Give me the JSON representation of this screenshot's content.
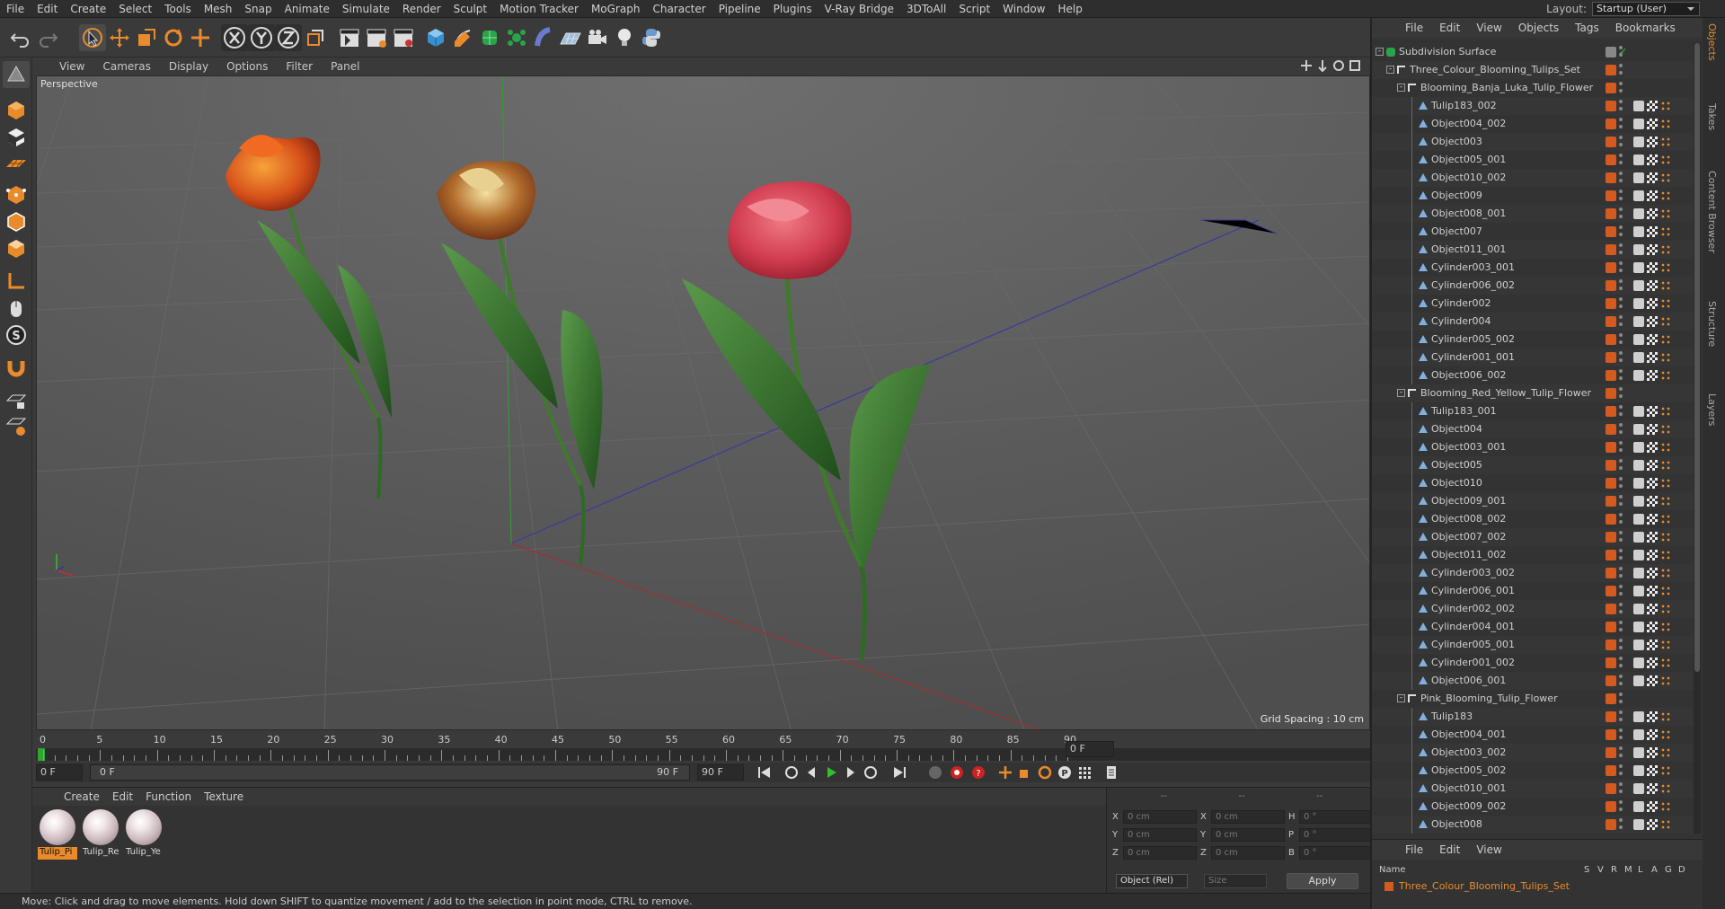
{
  "menu": [
    "File",
    "Edit",
    "Create",
    "Select",
    "Tools",
    "Mesh",
    "Snap",
    "Animate",
    "Simulate",
    "Render",
    "Sculpt",
    "Motion Tracker",
    "MoGraph",
    "Character",
    "Pipeline",
    "Plugins",
    "V-Ray Bridge",
    "3DToAll",
    "Script",
    "Window",
    "Help"
  ],
  "layout": {
    "label": "Layout:",
    "value": "Startup (User)"
  },
  "viewport": {
    "menu": [
      "View",
      "Cameras",
      "Display",
      "Options",
      "Filter",
      "Panel"
    ],
    "label": "Perspective",
    "grid_spacing": "Grid Spacing : 10 cm",
    "axis_y": "y",
    "axis_x": "x",
    "axis_z": "z"
  },
  "timeline": {
    "ticks": [
      "0",
      "5",
      "10",
      "15",
      "20",
      "25",
      "30",
      "35",
      "40",
      "45",
      "50",
      "55",
      "60",
      "65",
      "70",
      "75",
      "80",
      "85",
      "90"
    ],
    "end_field": "0 F",
    "start_field": "0 F",
    "range_start": "0 F",
    "range_end": "90 F",
    "max_field": "90 F"
  },
  "materials": {
    "menu": [
      "Create",
      "Edit",
      "Function",
      "Texture"
    ],
    "items": [
      {
        "name": "Tulip_Pi",
        "selected": true
      },
      {
        "name": "Tulip_Re",
        "selected": false
      },
      {
        "name": "Tulip_Ye",
        "selected": false
      }
    ]
  },
  "coords": {
    "header": [
      "--",
      "--",
      "--"
    ],
    "rows": [
      {
        "a": "X",
        "v1": "0 cm",
        "b": "X",
        "v2": "0 cm",
        "c": "H",
        "v3": "0 °"
      },
      {
        "a": "Y",
        "v1": "0 cm",
        "b": "Y",
        "v2": "0 cm",
        "c": "P",
        "v3": "0 °"
      },
      {
        "a": "Z",
        "v1": "0 cm",
        "b": "Z",
        "v2": "0 cm",
        "c": "B",
        "v3": "0 °"
      }
    ],
    "mode": "Object (Rel)",
    "size": "Size",
    "apply": "Apply"
  },
  "status": "Move: Click and drag to move elements. Hold down SHIFT to quantize movement / add to the selection in point mode, CTRL to remove.",
  "object_manager": {
    "menu": [
      "File",
      "Edit",
      "View",
      "Objects",
      "Tags",
      "Bookmarks"
    ],
    "objects": [
      {
        "name": "Subdivision Surface",
        "level": 0,
        "type": "sds"
      },
      {
        "name": "Three_Colour_Blooming_Tulips_Set",
        "level": 1,
        "type": "null"
      },
      {
        "name": "Blooming_Banja_Luka_Tulip_Flower",
        "level": 2,
        "type": "null"
      },
      {
        "name": "Tulip183_002",
        "level": 3,
        "type": "poly"
      },
      {
        "name": "Object004_002",
        "level": 3,
        "type": "poly"
      },
      {
        "name": "Object003",
        "level": 3,
        "type": "poly"
      },
      {
        "name": "Object005_001",
        "level": 3,
        "type": "poly"
      },
      {
        "name": "Object010_002",
        "level": 3,
        "type": "poly"
      },
      {
        "name": "Object009",
        "level": 3,
        "type": "poly"
      },
      {
        "name": "Object008_001",
        "level": 3,
        "type": "poly"
      },
      {
        "name": "Object007",
        "level": 3,
        "type": "poly"
      },
      {
        "name": "Object011_001",
        "level": 3,
        "type": "poly"
      },
      {
        "name": "Cylinder003_001",
        "level": 3,
        "type": "poly"
      },
      {
        "name": "Cylinder006_002",
        "level": 3,
        "type": "poly"
      },
      {
        "name": "Cylinder002",
        "level": 3,
        "type": "poly"
      },
      {
        "name": "Cylinder004",
        "level": 3,
        "type": "poly"
      },
      {
        "name": "Cylinder005_002",
        "level": 3,
        "type": "poly"
      },
      {
        "name": "Cylinder001_001",
        "level": 3,
        "type": "poly"
      },
      {
        "name": "Object006_002",
        "level": 3,
        "type": "poly"
      },
      {
        "name": "Blooming_Red_Yellow_Tulip_Flower",
        "level": 2,
        "type": "null"
      },
      {
        "name": "Tulip183_001",
        "level": 3,
        "type": "poly"
      },
      {
        "name": "Object004",
        "level": 3,
        "type": "poly"
      },
      {
        "name": "Object003_001",
        "level": 3,
        "type": "poly"
      },
      {
        "name": "Object005",
        "level": 3,
        "type": "poly"
      },
      {
        "name": "Object010",
        "level": 3,
        "type": "poly"
      },
      {
        "name": "Object009_001",
        "level": 3,
        "type": "poly"
      },
      {
        "name": "Object008_002",
        "level": 3,
        "type": "poly"
      },
      {
        "name": "Object007_002",
        "level": 3,
        "type": "poly"
      },
      {
        "name": "Object011_002",
        "level": 3,
        "type": "poly"
      },
      {
        "name": "Cylinder003_002",
        "level": 3,
        "type": "poly"
      },
      {
        "name": "Cylinder006_001",
        "level": 3,
        "type": "poly"
      },
      {
        "name": "Cylinder002_002",
        "level": 3,
        "type": "poly"
      },
      {
        "name": "Cylinder004_001",
        "level": 3,
        "type": "poly"
      },
      {
        "name": "Cylinder005_001",
        "level": 3,
        "type": "poly"
      },
      {
        "name": "Cylinder001_002",
        "level": 3,
        "type": "poly"
      },
      {
        "name": "Object006_001",
        "level": 3,
        "type": "poly"
      },
      {
        "name": "Pink_Blooming_Tulip_Flower",
        "level": 2,
        "type": "null"
      },
      {
        "name": "Tulip183",
        "level": 3,
        "type": "poly"
      },
      {
        "name": "Object004_001",
        "level": 3,
        "type": "poly"
      },
      {
        "name": "Object003_002",
        "level": 3,
        "type": "poly"
      },
      {
        "name": "Object005_002",
        "level": 3,
        "type": "poly"
      },
      {
        "name": "Object010_001",
        "level": 3,
        "type": "poly"
      },
      {
        "name": "Object009_002",
        "level": 3,
        "type": "poly"
      },
      {
        "name": "Object008",
        "level": 3,
        "type": "poly"
      }
    ]
  },
  "layers": {
    "menu": [
      "File",
      "Edit",
      "View"
    ],
    "columns": [
      "Name",
      "S",
      "V",
      "R",
      "M",
      "L",
      "A",
      "G",
      "D"
    ],
    "item": "Three_Colour_Blooming_Tulips_Set"
  },
  "side_tabs": [
    "Objects",
    "Takes",
    "Content Browser",
    "Structure",
    "Layers"
  ],
  "colors": {
    "accent": "#e98b2a",
    "selection": "#d45a1f",
    "x_axis": "#c03030",
    "z_axis": "#3030c0",
    "y_axis": "#30c030"
  }
}
